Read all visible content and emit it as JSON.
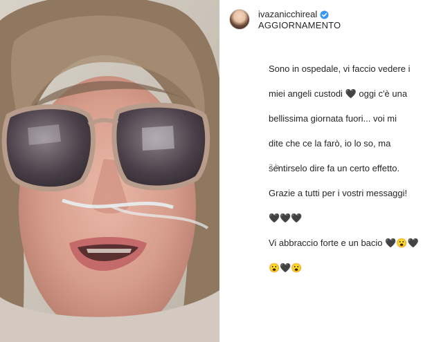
{
  "post": {
    "username": "ivazanicchireal",
    "subtitle": "AGGIORNAMENTO",
    "caption_lines": [
      "Sono in ospedale, vi faccio vedere i",
      "miei angeli custodi 🖤 oggi c'è una",
      "bellissima giornata fuori... voi mi",
      "dite che ce la farò, io lo so, ma",
      "sentirselo dire fa un certo effetto.",
      "Grazie a tutti per i vostri messaggi!",
      "🖤🖤🖤",
      "Vi abbraccio forte e un bacio 🖤😮🖤",
      "😮🖤😮"
    ],
    "time_ago": "3 h"
  },
  "colors": {
    "verified": "#3897f0",
    "text": "#262626",
    "muted": "#8e8e8e"
  },
  "icons": {
    "verified": "verified-badge-icon"
  }
}
